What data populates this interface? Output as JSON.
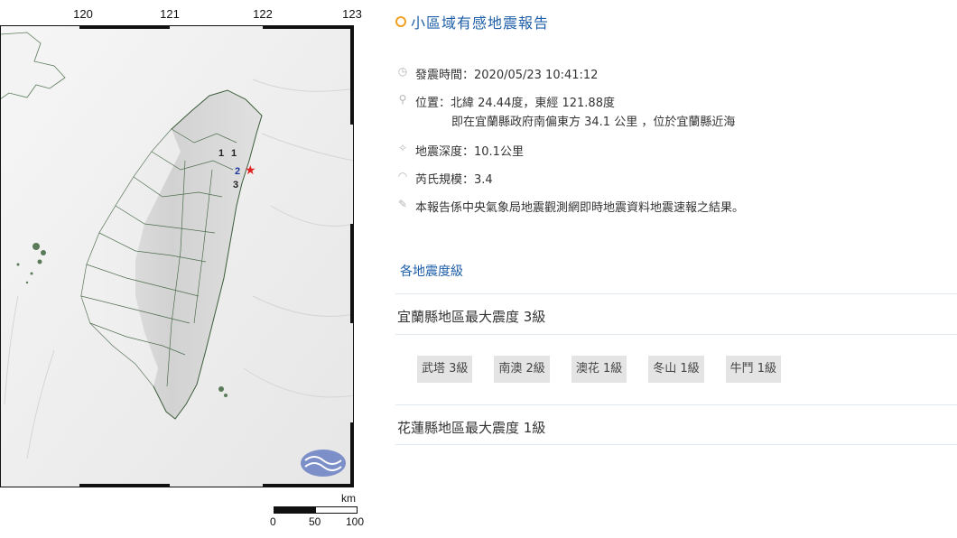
{
  "map": {
    "longitudes": [
      "120",
      "121",
      "122",
      "123"
    ],
    "epicenter_label": "★",
    "station_marks": [
      "1",
      "1",
      "2",
      "3"
    ],
    "scale": {
      "unit": "km",
      "ticks": [
        "0",
        "50",
        "100"
      ]
    }
  },
  "report": {
    "title": "小區域有感地震報告",
    "time": "發震時間：2020/05/23 10:41:12",
    "location_line1": "位置：北緯 24.44度，東經 121.88度",
    "location_line2": "即在宜蘭縣政府南偏東方 34.1 公里 ，位於宜蘭縣近海",
    "depth": "地震深度：10.1公里",
    "magnitude": "芮氏規模：3.4",
    "note": "本報告係中央氣象局地震觀測網即時地震資料地震速報之結果。",
    "intensity_link": "各地震度級",
    "regions": [
      {
        "title": "宜蘭縣地區最大震度 3級",
        "stations": [
          "武塔 3級",
          "南澳 2級",
          "澳花 1級",
          "冬山 1級",
          "牛鬥 1級"
        ]
      },
      {
        "title": "花蓮縣地區最大震度 1級",
        "stations": []
      }
    ]
  },
  "icons": {
    "title": "ring-icon",
    "time": "clock-icon",
    "location": "pin-icon",
    "depth": "star-icon",
    "magnitude": "gauge-icon",
    "note": "pencil-icon"
  },
  "colors": {
    "title_blue": "#1f5fa8",
    "title_dot": "#f0a020",
    "epicenter": "#e02020",
    "chip_bg": "#e4e4e4"
  }
}
